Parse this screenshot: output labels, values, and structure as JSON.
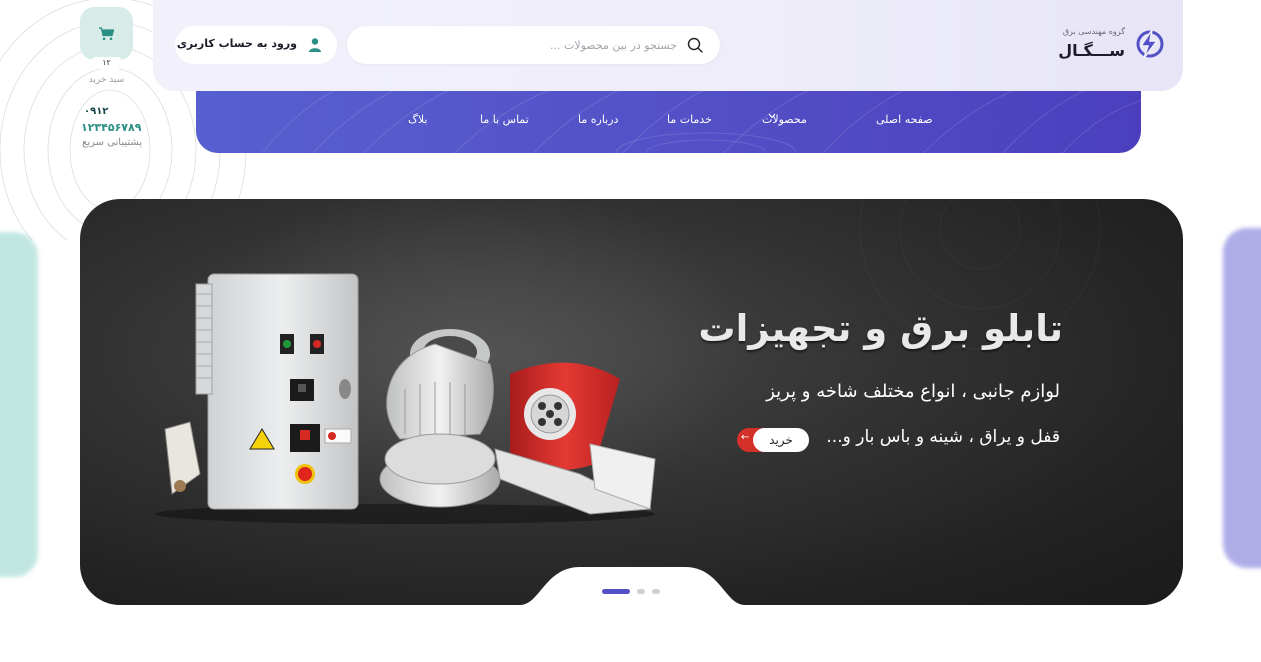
{
  "header": {
    "logo": {
      "subtitle": "گروه مهندسی برق",
      "name": "ســـگـال"
    },
    "search": {
      "placeholder": "جستجو در بین محصولات ...",
      "value": ""
    },
    "login": {
      "label": "ورود به حساب کاربری"
    },
    "cart": {
      "count": "۱۲",
      "label": "سبد خرید"
    },
    "support": {
      "prefix": "۰۹۱۲",
      "number": "۱۲۳۴۵۶۷۸۹",
      "label": "پشتیبانی سریع"
    }
  },
  "nav": {
    "items": [
      {
        "label": "صفحه اصلی"
      },
      {
        "label": "محصولات"
      },
      {
        "label": "خدمات ما"
      },
      {
        "label": "درباره ما"
      },
      {
        "label": "تماس با ما"
      },
      {
        "label": "بلاگ"
      }
    ]
  },
  "hero": {
    "title": "تابلو برق و تجهیزات",
    "line1": "لوازم جانبی ، انواع مختلف شاخه و پریز",
    "line2": "قفل و یراق ، شینه و باس بار و...",
    "button": "خرید",
    "slides_total": 3,
    "active_slide": 1
  },
  "colors": {
    "nav_start": "#5660d0",
    "nav_end": "#4b3fbe",
    "accent_teal": "#2a8f84",
    "cart_bg": "#d7ece8",
    "buy_red": "#d3302a",
    "hero_bg": "#2a2a2a"
  },
  "icons": [
    "logo-bolt-icon",
    "search-icon",
    "user-icon",
    "cart-icon",
    "chevron-down-icon",
    "arrow-left-icon"
  ]
}
